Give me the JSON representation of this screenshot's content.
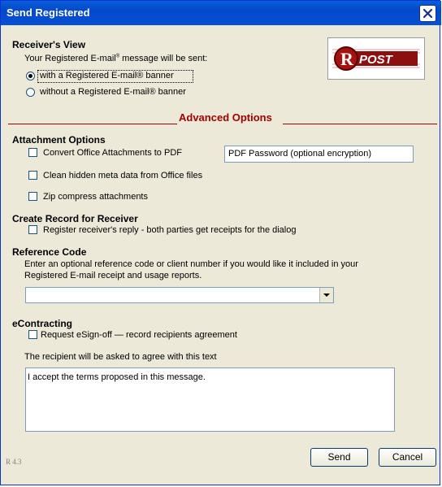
{
  "window": {
    "title": "Send Registered",
    "close_icon": "close-icon"
  },
  "receiver_view": {
    "heading": "Receiver's View",
    "intro_before": "Your Registered E-mail",
    "intro_after": " message will be sent:",
    "options": [
      {
        "label": "with a Registered E-mail® banner",
        "selected": true
      },
      {
        "label": "without a Registered E-mail® banner",
        "selected": false
      }
    ]
  },
  "logo": {
    "text": "POST",
    "letter": "R"
  },
  "advanced": {
    "heading": "Advanced Options"
  },
  "attachment_options": {
    "heading": "Attachment Options",
    "convert_label": "Convert Office Attachments to PDF",
    "pdf_password_value": "PDF Password (optional encryption)",
    "clean_meta_label": "Clean hidden meta data from Office files",
    "zip_label": "Zip compress attachments"
  },
  "create_record": {
    "heading": "Create Record for Receiver",
    "register_label": "Register receiver's reply - both parties get receipts for the dialog"
  },
  "reference_code": {
    "heading": "Reference Code",
    "description_line1": "Enter an optional reference code or client number if you would like it included in your",
    "description_line2": "Registered E-mail receipt and usage reports.",
    "selected_value": ""
  },
  "econtracting": {
    "heading": "eContracting",
    "esign_label": "Request eSign-off — record recipients agreement",
    "agree_prompt": "The recipient will be asked to agree with this text",
    "agree_text": "I accept the terms proposed in this message."
  },
  "footer": {
    "version": "R 4.3",
    "send_label": "Send",
    "cancel_label": "Cancel"
  }
}
